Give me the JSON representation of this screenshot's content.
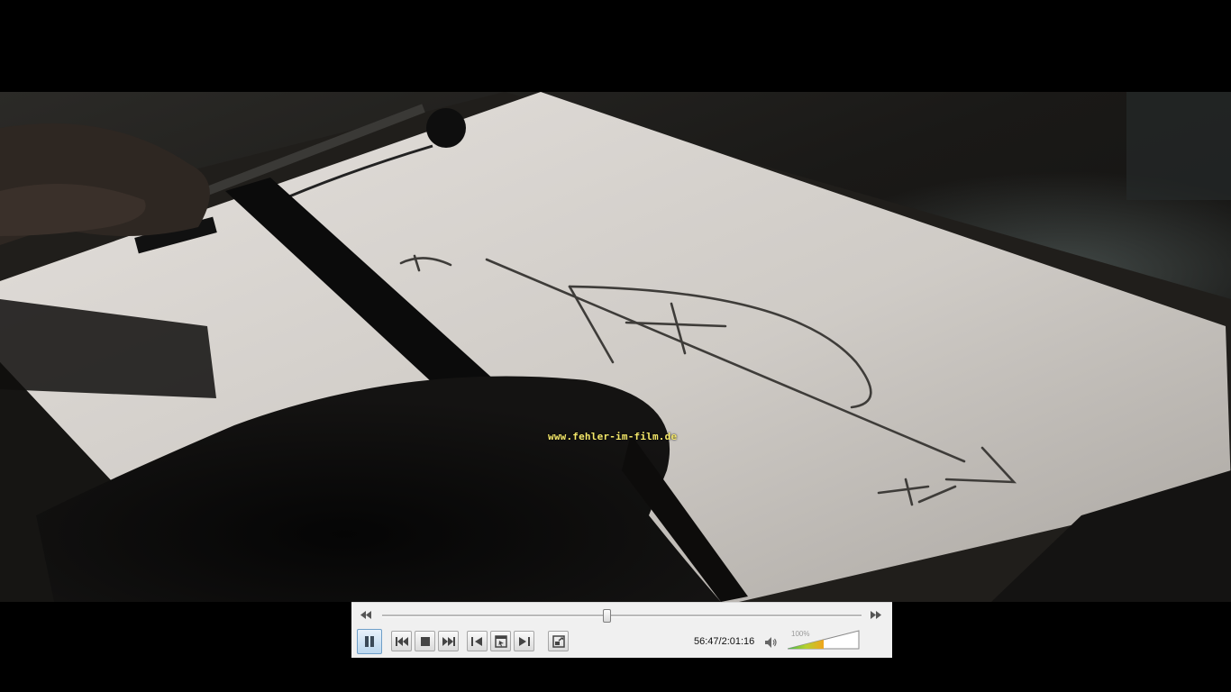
{
  "video": {
    "watermark": "www.fehler-im-film.de"
  },
  "controller": {
    "current_time": "56:47",
    "total_time": "2:01:16",
    "time_display": "56:47/2:01:16",
    "progress_fraction": 0.468,
    "volume_label": "100%",
    "volume_fraction": 1.0,
    "accent_color": "#3d83c4",
    "buttons": [
      {
        "name": "pause-button",
        "icon": "pause-icon"
      },
      {
        "name": "previous-button",
        "icon": "skip-previous-icon"
      },
      {
        "name": "stop-button",
        "icon": "stop-icon"
      },
      {
        "name": "next-button",
        "icon": "skip-next-icon"
      },
      {
        "name": "frame-back-button",
        "icon": "frame-back-icon"
      },
      {
        "name": "toggle-video-button",
        "icon": "video-window-icon"
      },
      {
        "name": "frame-forward-button",
        "icon": "frame-forward-icon"
      },
      {
        "name": "fullscreen-button",
        "icon": "fullscreen-icon"
      }
    ]
  }
}
